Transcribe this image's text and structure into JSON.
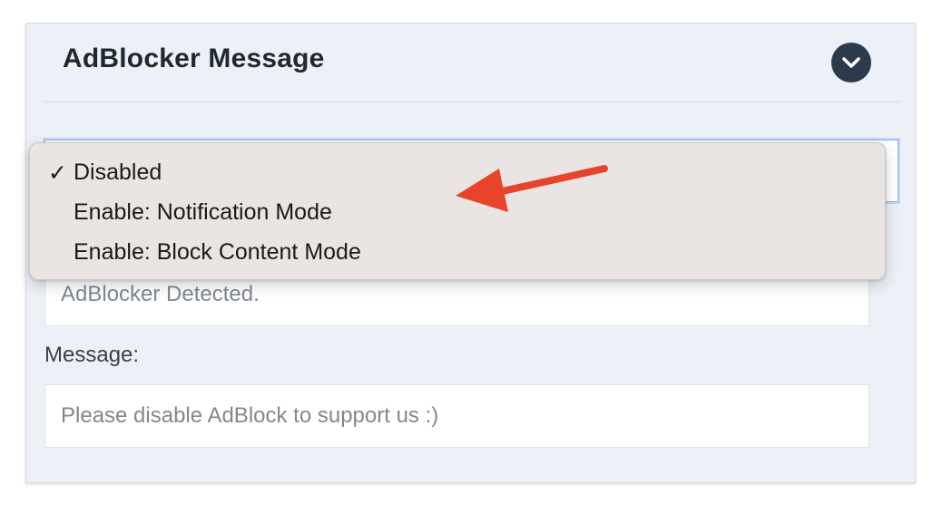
{
  "panel": {
    "title": "AdBlocker Message",
    "collapse_icon": "chevron-down-icon"
  },
  "mode_select": {
    "selected": "Disabled",
    "options": [
      {
        "label": "Disabled",
        "checked": true
      },
      {
        "label": "Enable: Notification Mode",
        "checked": false
      },
      {
        "label": "Enable: Block Content Mode",
        "checked": false
      }
    ],
    "check_glyph": "✓"
  },
  "title_field": {
    "placeholder": "AdBlocker Detected."
  },
  "message_field": {
    "label": "Message:",
    "placeholder": "Please disable AdBlock to support us :)"
  },
  "annotation": {
    "icon": "arrow-icon",
    "color": "#e8432b"
  },
  "colors": {
    "panel_bg": "#edf1f7",
    "collapse_button": "#2b3a4d",
    "focus_border": "#8ab4e6"
  }
}
